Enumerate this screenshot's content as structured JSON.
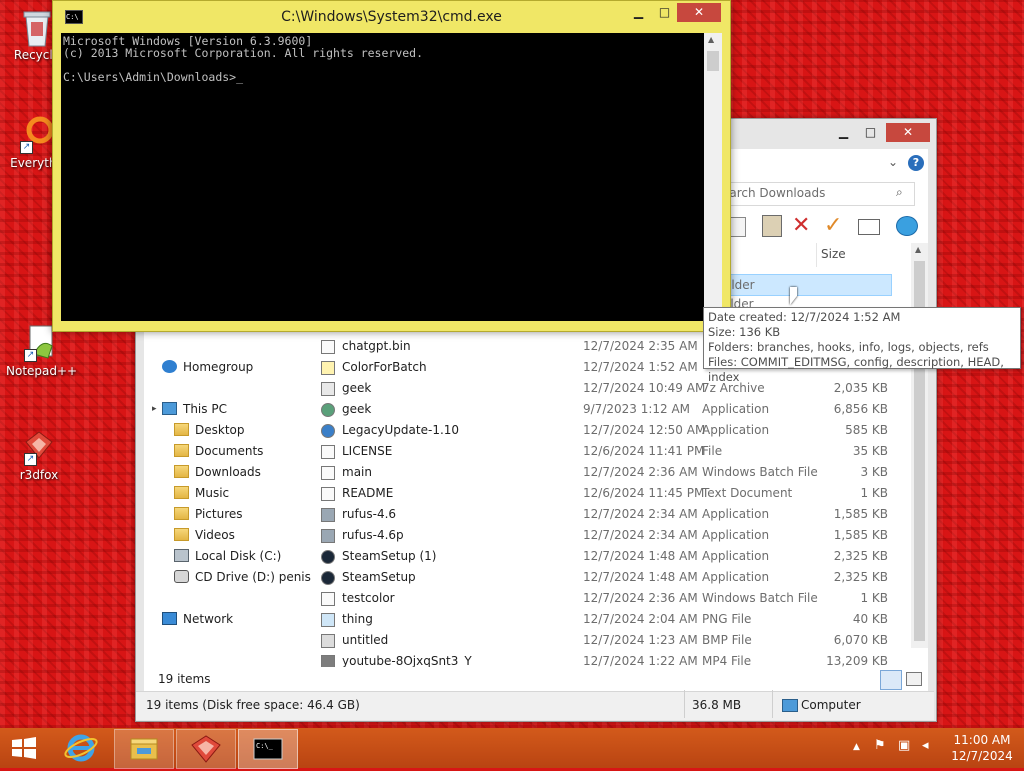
{
  "desktop": {
    "icons": [
      {
        "label": "Recycle",
        "icon": "recycle-bin-icon"
      },
      {
        "label": "Everythi",
        "icon": "everything-search-icon"
      },
      {
        "label": "Notepad++",
        "icon": "notepadpp-icon"
      },
      {
        "label": "r3dfox",
        "icon": "r3dfox-icon"
      }
    ]
  },
  "cmd": {
    "title": "C:\\Windows\\System32\\cmd.exe",
    "icon": "cmd-icon",
    "lines": [
      "Microsoft Windows [Version 6.3.9600]",
      "(c) 2013 Microsoft Corporation. All rights reserved.",
      "",
      "C:\\Users\\Admin\\Downloads>_"
    ],
    "controls": {
      "minimize": "▁",
      "maximize": "□",
      "close": "✕"
    }
  },
  "explorer": {
    "controls": {
      "minimize": "▁",
      "maximize": "□",
      "close": "✕"
    },
    "help_icon": "?",
    "search_placeholder": "earch Downloads",
    "column_size": "Size",
    "selected_partial": "older",
    "selected_partial_2": "older",
    "nav": [
      {
        "label": "Homegroup",
        "icon": "homegroup-icon"
      },
      {
        "label": "This PC",
        "icon": "this-pc-icon"
      },
      {
        "label": "Desktop",
        "icon": "folder-icon"
      },
      {
        "label": "Documents",
        "icon": "folder-icon"
      },
      {
        "label": "Downloads",
        "icon": "folder-icon"
      },
      {
        "label": "Music",
        "icon": "folder-icon"
      },
      {
        "label": "Pictures",
        "icon": "folder-icon"
      },
      {
        "label": "Videos",
        "icon": "folder-icon"
      },
      {
        "label": "Local Disk (C:)",
        "icon": "drive-icon"
      },
      {
        "label": "CD Drive (D:) penis",
        "icon": "cd-drive-icon"
      },
      {
        "label": "Network",
        "icon": "network-icon"
      }
    ],
    "files": [
      {
        "name": "chatgpt.bin",
        "date": "12/7/2024 2:35 AM",
        "type": "",
        "size": ""
      },
      {
        "name": "ColorForBatch",
        "date": "12/7/2024 1:52 AM",
        "type": "",
        "size": ""
      },
      {
        "name": "geek",
        "date": "12/7/2024 10:49 AM",
        "type": "7z Archive",
        "size": "2,035 KB"
      },
      {
        "name": "geek",
        "date": "9/7/2023 1:12 AM",
        "type": "Application",
        "size": "6,856 KB"
      },
      {
        "name": "LegacyUpdate-1.10",
        "date": "12/7/2024 12:50 AM",
        "type": "Application",
        "size": "585 KB"
      },
      {
        "name": "LICENSE",
        "date": "12/6/2024 11:41 PM",
        "type": "File",
        "size": "35 KB"
      },
      {
        "name": "main",
        "date": "12/7/2024 2:36 AM",
        "type": "Windows Batch File",
        "size": "3 KB"
      },
      {
        "name": "README",
        "date": "12/6/2024 11:45 PM",
        "type": "Text Document",
        "size": "1 KB"
      },
      {
        "name": "rufus-4.6",
        "date": "12/7/2024 2:34 AM",
        "type": "Application",
        "size": "1,585 KB"
      },
      {
        "name": "rufus-4.6p",
        "date": "12/7/2024 2:34 AM",
        "type": "Application",
        "size": "1,585 KB"
      },
      {
        "name": "SteamSetup (1)",
        "date": "12/7/2024 1:48 AM",
        "type": "Application",
        "size": "2,325 KB"
      },
      {
        "name": "SteamSetup",
        "date": "12/7/2024 1:48 AM",
        "type": "Application",
        "size": "2,325 KB"
      },
      {
        "name": "testcolor",
        "date": "12/7/2024 2:36 AM",
        "type": "Windows Batch File",
        "size": "1 KB"
      },
      {
        "name": "thing",
        "date": "12/7/2024 2:04 AM",
        "type": "PNG File",
        "size": "40 KB"
      },
      {
        "name": "untitled",
        "date": "12/7/2024 1:23 AM",
        "type": "BMP File",
        "size": "6,070 KB"
      },
      {
        "name": "youtube-8OjxqSnt3_Y",
        "date": "12/7/2024 1:22 AM",
        "type": "MP4 File",
        "size": "13,209 KB"
      }
    ],
    "item_count": "19 items",
    "status": {
      "disk": "19 items (Disk free space: 46.4 GB)",
      "size": "36.8 MB",
      "location": "Computer"
    }
  },
  "tooltip": {
    "lines": [
      "Date created: 12/7/2024 1:52 AM",
      "Size: 136 KB",
      "Folders: branches, hooks, info, logs, objects, refs",
      "Files: COMMIT_EDITMSG, config, description, HEAD, index"
    ]
  },
  "taskbar": {
    "time": "11:00 AM",
    "date": "12/7/2024",
    "buttons": [
      "start-icon",
      "ie-icon",
      "file-explorer-icon",
      "r3dfox-icon",
      "cmd-icon"
    ]
  }
}
